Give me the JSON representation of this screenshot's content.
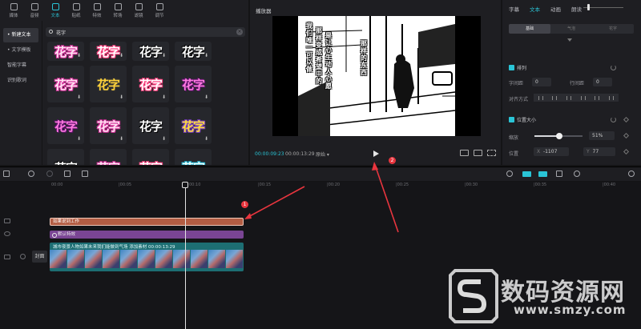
{
  "toolbar": {
    "tabs": [
      {
        "label": "媒体",
        "icon": "media-icon"
      },
      {
        "label": "音频",
        "icon": "audio-icon"
      },
      {
        "label": "文本",
        "icon": "text-icon"
      },
      {
        "label": "贴纸",
        "icon": "sticker-icon"
      },
      {
        "label": "特效",
        "icon": "effects-icon"
      },
      {
        "label": "转场",
        "icon": "transition-icon"
      },
      {
        "label": "滤镜",
        "icon": "filter-icon"
      },
      {
        "label": "调节",
        "icon": "adjust-icon"
      }
    ],
    "active_index": 2
  },
  "sidebar": {
    "items": [
      {
        "label": "• 新建文本"
      },
      {
        "label": "• 文字模板"
      },
      {
        "label": "智能字幕"
      },
      {
        "label": "识别歌词"
      }
    ]
  },
  "search": {
    "value": "花字"
  },
  "templates": {
    "tile_text": "花字",
    "download_glyph": "⬇"
  },
  "player": {
    "title": "播放器",
    "current_time": "00:00:09:23",
    "total_time": "00:00:13:29",
    "ratio": "原始 ▾",
    "overlay_col1": "我们唯一可以做",
    "overlay_col2": "那样变成希望中的",
    "overlay_col3": "是让心生动人心愿",
    "overlay_col4": "那样的东西"
  },
  "inspector": {
    "tabs": [
      "字幕",
      "文本",
      "动画",
      "朗读"
    ],
    "active_tab": 1,
    "sub_tabs": [
      "基础",
      "气泡",
      "花字"
    ],
    "arrange_label": "排列",
    "char_spacing_label": "字间距",
    "char_spacing_value": "0",
    "line_spacing_label": "行间距",
    "line_spacing_value": "0",
    "align_label": "对齐方式",
    "position_size_label": "位置大小",
    "scale_label": "缩放",
    "scale_value": "51%",
    "scale_fraction": 0.51,
    "position_label": "位置",
    "pos_x_label": "X",
    "pos_x_value": "-1107",
    "pos_y_label": "Y",
    "pos_y_value": "77"
  },
  "timeline": {
    "ruler_ticks": [
      "00:00",
      "|00:05",
      "00:10",
      "|00:15",
      "|00:20",
      "|00:25",
      "|00:30",
      "|00:35",
      "|00:40"
    ],
    "text_clip_label": "如果说到工作",
    "effect_clip_label": "默认特效",
    "video_clip_label": "城市夜景人物如果未来我们能做到气场 添加素材   00:00:13:29",
    "cover_label": "封面",
    "annotation_1": "1",
    "annotation_2": "2"
  },
  "watermark": {
    "text": "数码资源网",
    "url": "www.smzy.com"
  },
  "colors": {
    "accent": "#2ac4d6",
    "text_clip": "#b35d43",
    "effect_clip": "#7a4594",
    "video_clip": "#1d6e73",
    "annotation": "#e8353e"
  }
}
